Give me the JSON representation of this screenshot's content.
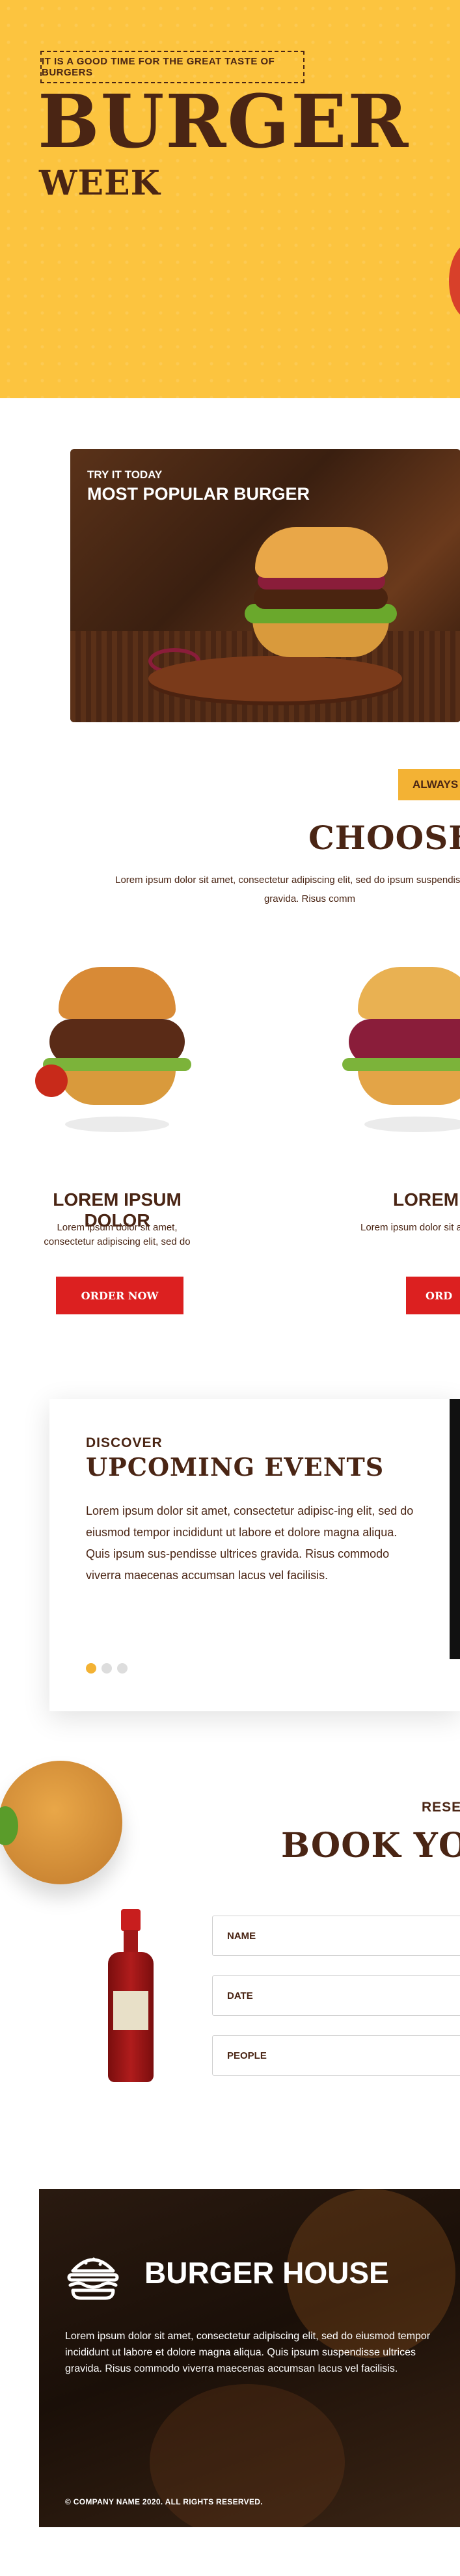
{
  "hero": {
    "tagline": "IT IS A GOOD TIME FOR THE GREAT TASTE OF BURGERS",
    "title": "BURGER",
    "subtitle": "WEEK"
  },
  "featured": {
    "kicker": "TRY IT TODAY",
    "title": "MOST POPULAR BURGER"
  },
  "choose": {
    "badge": "ALWAYS T",
    "title": "CHOOSE",
    "text": "Lorem ipsum dolor sit amet, consectetur adipiscing elit, sed do ipsum suspendisse ultrices gravida. Risus comm"
  },
  "products": [
    {
      "name": "LOREM IPSUM DOLOR",
      "description": "Lorem ipsum dolor sit amet, consectetur adipiscing elit, sed do",
      "button": "ORDER NOW"
    },
    {
      "name": "LOREM IP",
      "description": "Lorem ipsum dolor sit amet, adipiscin",
      "button": "ORD"
    }
  ],
  "events": {
    "kicker": "DISCOVER",
    "title": "UPCOMING EVENTS",
    "text": "Lorem ipsum dolor sit amet, consectetur adipisc-ing elit, sed do eiusmod tempor incididunt ut labore et dolore magna aliqua. Quis ipsum sus-pendisse ultrices gravida. Risus commodo viverra maecenas accumsan lacus vel facilisis."
  },
  "booking": {
    "kicker": "RESE",
    "title": "BOOK YO",
    "fields": {
      "name": "NAME",
      "date": "DATE",
      "people": "PEOPLE"
    }
  },
  "footer": {
    "brand": "BURGER HOUSE",
    "text": "Lorem ipsum dolor sit amet, consectetur adipiscing elit, sed do eiusmod tempor incididunt ut labore et dolore magna aliqua. Quis ipsum suspendisse ultrices gravida. Risus commodo viverra maecenas accumsan lacus vel facilisis.",
    "copyright": "© COMPANY NAME 2020. ALL RIGHTS RESERVED."
  },
  "colors": {
    "brand_yellow": "#fcc43f",
    "brand_brown": "#4a2514",
    "accent_red": "#dc2020",
    "active_dot": "#f3b234"
  },
  "carousel": {
    "slides": 3,
    "active_index": 0
  }
}
